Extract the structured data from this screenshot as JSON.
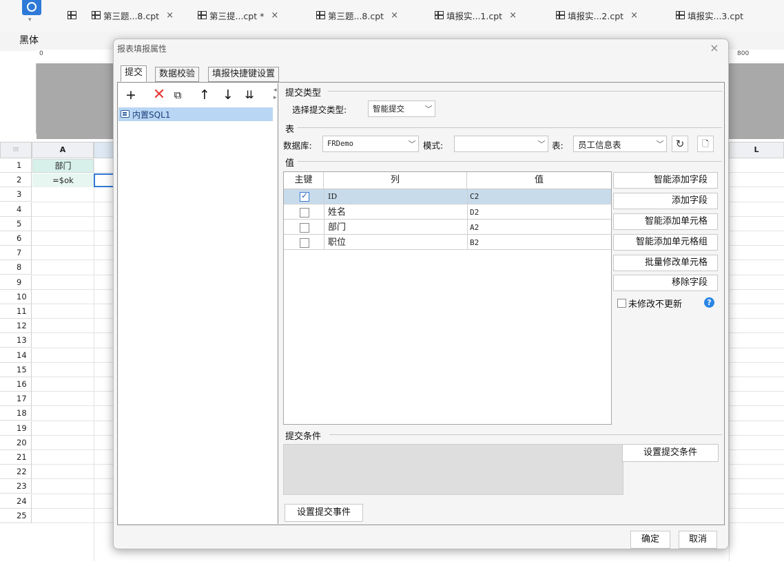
{
  "topbar": {
    "font_name": "黑体",
    "tabs": [
      {
        "label": "第三题...8.cpt",
        "close": "×"
      },
      {
        "label": "第三提...cpt *",
        "close": "×"
      },
      {
        "label": "第三题...8.cpt",
        "close": "×"
      },
      {
        "label": "填报实...1.cpt",
        "close": "×"
      },
      {
        "label": "填报实...2.cpt",
        "close": "×"
      },
      {
        "label": "填报实...3.cpt",
        "close": ""
      }
    ]
  },
  "ruler": {
    "zero": "0",
    "mark_800": "800"
  },
  "sheet": {
    "columns": [
      "A",
      "L"
    ],
    "rows": [
      "1",
      "2",
      "3",
      "4",
      "5",
      "6",
      "7",
      "8",
      "9",
      "10",
      "11",
      "12",
      "13",
      "14",
      "15",
      "16",
      "17",
      "18",
      "19",
      "20",
      "21",
      "22",
      "23",
      "24",
      "25"
    ],
    "a1": "部门",
    "a2": "=$ok"
  },
  "dialog": {
    "title": "报表填报属性",
    "close": "×",
    "tabs": [
      "提交",
      "数据校验",
      "填报快捷键设置"
    ],
    "toolbar_icons": [
      "add-icon",
      "delete-icon",
      "copy-icon",
      "move-up-icon",
      "move-down-icon",
      "sort-icon"
    ],
    "submit_list": [
      "内置SQL1"
    ],
    "submit_type": {
      "section": "提交类型",
      "label": "选择提交类型:",
      "value": "智能提交"
    },
    "table_section": {
      "section": "表",
      "db_label": "数据库:",
      "db_value": "FRDemo",
      "mode_label": "模式:",
      "mode_value": "",
      "table_label": "表:",
      "table_value": "员工信息表"
    },
    "value_section": {
      "section": "值",
      "headers": [
        "主键",
        "列",
        "值"
      ],
      "rows": [
        {
          "key": true,
          "col": "ID",
          "val": "C2"
        },
        {
          "key": false,
          "col": "姓名",
          "val": "D2"
        },
        {
          "key": false,
          "col": "部门",
          "val": "A2"
        },
        {
          "key": false,
          "col": "职位",
          "val": "B2"
        }
      ],
      "buttons": [
        "智能添加字段",
        "添加字段",
        "智能添加单元格",
        "智能添加单元格组",
        "批量修改单元格",
        "移除字段"
      ],
      "no_update_label": "未修改不更新"
    },
    "condition_section": {
      "section": "提交条件",
      "button": "设置提交条件"
    },
    "event_button": "设置提交事件",
    "ok": "确定",
    "cancel": "取消"
  }
}
